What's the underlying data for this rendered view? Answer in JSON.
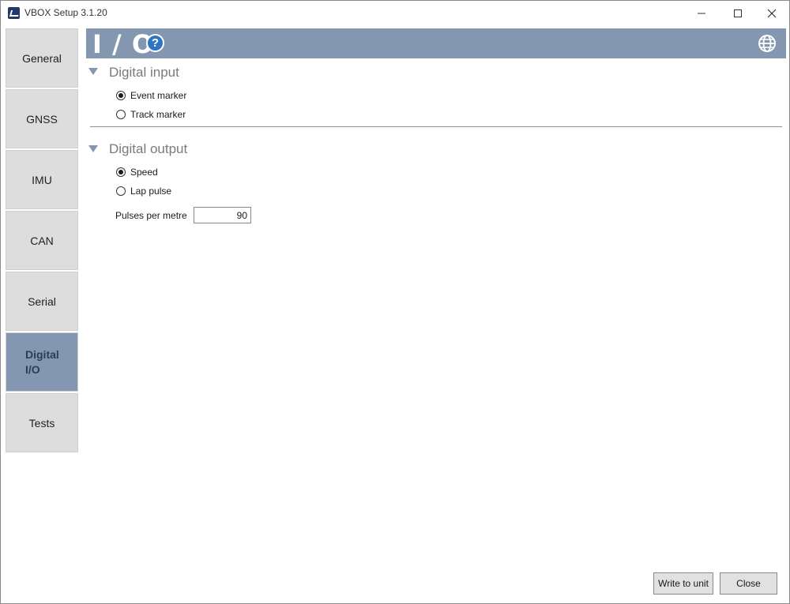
{
  "window": {
    "title": "VBOX Setup 3.1.20"
  },
  "sidebar": {
    "items": [
      {
        "label": "General"
      },
      {
        "label": "GNSS"
      },
      {
        "label": "IMU"
      },
      {
        "label": "CAN"
      },
      {
        "label": "Serial"
      },
      {
        "label": "Digital I/O",
        "active": true
      },
      {
        "label": "Tests"
      }
    ]
  },
  "header": {
    "title": "I / O",
    "help_icon": "?",
    "globe_icon": "globe-icon",
    "color": "#8497b0"
  },
  "digital_input": {
    "title": "Digital input",
    "options": [
      {
        "label": "Event marker",
        "checked": true
      },
      {
        "label": "Track marker",
        "checked": false
      }
    ]
  },
  "digital_output": {
    "title": "Digital output",
    "options": [
      {
        "label": "Speed",
        "checked": true
      },
      {
        "label": "Lap pulse",
        "checked": false
      }
    ],
    "pulses_per_metre": {
      "label": "Pulses per metre",
      "value": "90"
    }
  },
  "footer": {
    "write_label": "Write to unit",
    "close_label": "Close"
  }
}
